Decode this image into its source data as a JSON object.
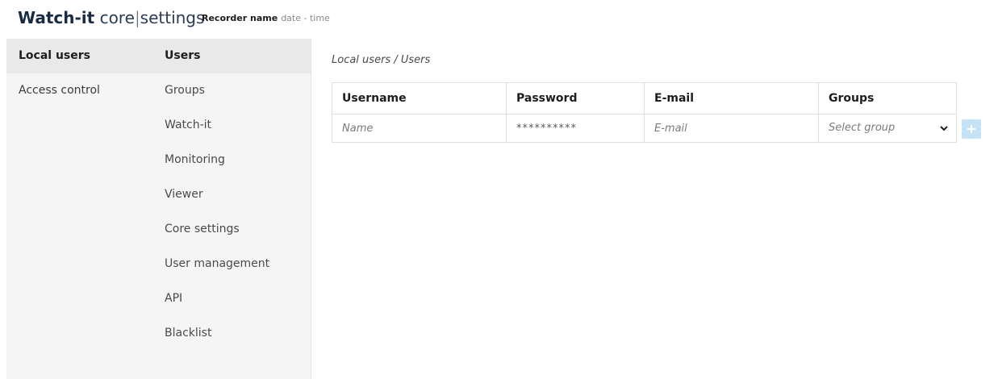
{
  "header": {
    "brand_name": "Watch-it",
    "brand_core": "core",
    "brand_sep": "|",
    "brand_settings": "settings",
    "recorder_name": "Recorder name",
    "date_time": "date - time"
  },
  "sidebar": {
    "items": [
      {
        "label": "Local users",
        "active": true
      },
      {
        "label": "Access control",
        "active": false
      }
    ]
  },
  "subnav": {
    "items": [
      {
        "label": "Users",
        "active": true
      },
      {
        "label": "Groups"
      },
      {
        "label": "Watch-it"
      },
      {
        "label": "Monitoring"
      },
      {
        "label": "Viewer"
      },
      {
        "label": "Core settings"
      },
      {
        "label": "User management"
      },
      {
        "label": "API"
      },
      {
        "label": "Blacklist"
      }
    ]
  },
  "main": {
    "breadcrumb": "Local users / Users",
    "table": {
      "headers": [
        "Username",
        "Password",
        "E-mail",
        "Groups"
      ],
      "new_row": {
        "username_placeholder": "Name",
        "password_mask": "**********",
        "email_placeholder": "E-mail",
        "group_select": "Select group"
      }
    },
    "add_button_icon": "plus-icon"
  },
  "colors": {
    "sidebar_bg": "#f5f5f5",
    "active_bg": "#e9e9e9",
    "add_button_bg": "#c6e2f6",
    "brand_color": "#1a2b45"
  }
}
